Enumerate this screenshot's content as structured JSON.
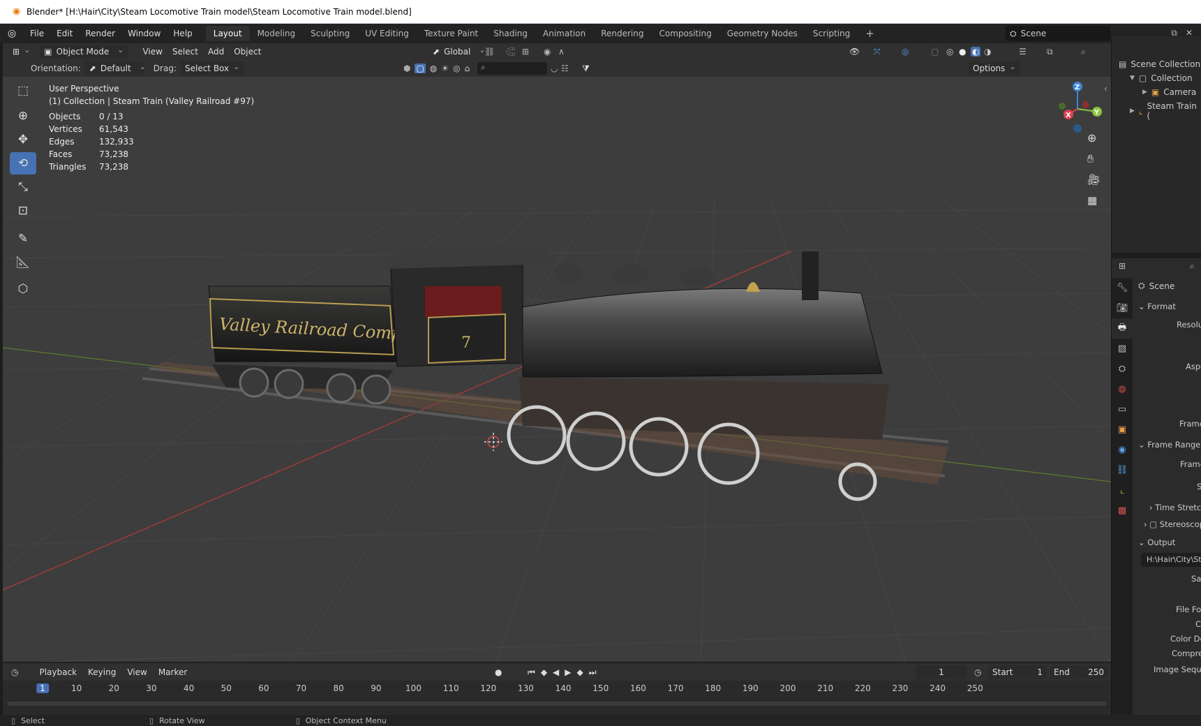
{
  "window": {
    "title": "Blender* [H:\\Hair\\City\\Steam Locomotive Train model\\Steam Locomotive Train model.blend]"
  },
  "topbar": {
    "menus": [
      "File",
      "Edit",
      "Render",
      "Window",
      "Help"
    ],
    "workspaces": [
      "Layout",
      "Modeling",
      "Sculpting",
      "UV Editing",
      "Texture Paint",
      "Shading",
      "Animation",
      "Rendering",
      "Compositing",
      "Geometry Nodes",
      "Scripting"
    ],
    "add_symbol": "+",
    "scene_name": "Scene"
  },
  "viewport_header": {
    "mode": "Object Mode",
    "menus": [
      "View",
      "Select",
      "Add",
      "Object"
    ],
    "transform_orientation": "Global",
    "options_label": "Options",
    "orientation_label": "Orientation:",
    "orientation_value": "Default",
    "drag_label": "Drag:",
    "drag_value": "Select Box"
  },
  "viewport": {
    "view_name": "User Perspective",
    "active_context": "(1) Collection | Steam Train (Valley Railroad #97)",
    "stats": [
      {
        "label": "Objects",
        "value": "0 / 13"
      },
      {
        "label": "Vertices",
        "value": "61,543"
      },
      {
        "label": "Edges",
        "value": "132,933"
      },
      {
        "label": "Faces",
        "value": "73,238"
      },
      {
        "label": "Triangles",
        "value": "73,238"
      }
    ],
    "gizmo_axes": {
      "x": "X",
      "y": "Y",
      "z": "Z"
    },
    "tender_text": "Valley Railroad Company",
    "cab_number": "7"
  },
  "outliner": {
    "root": "Scene Collection",
    "collection": "Collection",
    "items": [
      "Camera",
      "Steam Train ("
    ]
  },
  "properties": {
    "context": "Scene",
    "sections": {
      "format": "Format",
      "frame_range": "Frame Range",
      "output": "Output",
      "time_stretch": "Time Stretc",
      "stereoscopy": "Stereoscopy"
    },
    "labels": {
      "resolution": "Resolutio",
      "aspect": "Aspe",
      "frame_rate": "Frame R",
      "frame_start": "Frame S",
      "step": "S",
      "save": "Sa",
      "file_format": "File For",
      "color": "C",
      "color_depth": "Color De",
      "compression": "Compres",
      "image_sequence": "Image Seque"
    },
    "output_path": "H:\\Hair\\City\\Ste"
  },
  "timeline": {
    "menus": [
      "Playback",
      "Keying",
      "View",
      "Marker"
    ],
    "current_frame": "1",
    "start_label": "Start",
    "start": "1",
    "end_label": "End",
    "end": "250",
    "ruler": [
      "1",
      "10",
      "20",
      "30",
      "40",
      "50",
      "60",
      "70",
      "80",
      "90",
      "100",
      "110",
      "120",
      "130",
      "140",
      "150",
      "160",
      "170",
      "180",
      "190",
      "200",
      "210",
      "220",
      "230",
      "240",
      "250"
    ]
  },
  "statusbar": {
    "items": [
      "Select",
      "Rotate View",
      "Object Context Menu"
    ]
  },
  "colors": {
    "accent": "#4772b3",
    "axis_x": "#e0414f",
    "axis_y": "#8cc63f",
    "axis_z": "#3d86d6",
    "grid": "#4a4a4a"
  }
}
